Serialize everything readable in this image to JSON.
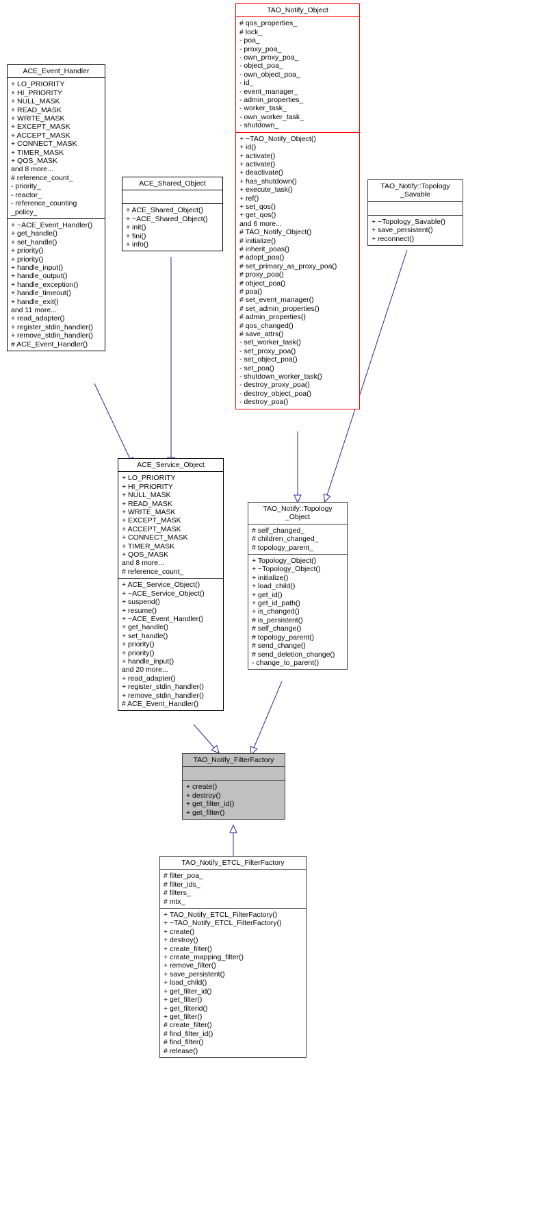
{
  "diagram": {
    "title": "TAO_Notify_FilterFactory inheritance diagram",
    "colors": {
      "highlight_border": "#ff0000",
      "selected_fill": "#c0c0c0",
      "edge": "#25258f",
      "default_border": "#000000"
    }
  },
  "classes": {
    "tao_notify_object": {
      "name": "TAO_Notify_Object",
      "attributes": [
        "# qos_properties_",
        "# lock_",
        "- poa_",
        "- proxy_poa_",
        "- own_proxy_poa_",
        "- object_poa_",
        "- own_object_poa_",
        "- id_",
        "- event_manager_",
        "- admin_properties_",
        "- worker_task_",
        "- own_worker_task_",
        "- shutdown_"
      ],
      "operations": [
        "+ ~TAO_Notify_Object()",
        "+ id()",
        "+ activate()",
        "+ activate()",
        "+ deactivate()",
        "+ has_shutdown()",
        "+ execute_task()",
        "+ ref()",
        "+ set_qos()",
        "+ get_qos()",
        "and 6 more...",
        "# TAO_Notify_Object()",
        "# initialize()",
        "# inherit_poas()",
        "# adopt_poa()",
        "# set_primary_as_proxy_poa()",
        "# proxy_poa()",
        "# object_poa()",
        "# poa()",
        "# set_event_manager()",
        "# set_admin_properties()",
        "# admin_properties()",
        "# qos_changed()",
        "# save_attrs()",
        "- set_worker_task()",
        "- set_proxy_poa()",
        "- set_object_poa()",
        "- set_poa()",
        "- shutdown_worker_task()",
        "- destroy_proxy_poa()",
        "- destroy_object_poa()",
        "- destroy_poa()"
      ]
    },
    "ace_event_handler": {
      "name": "ACE_Event_Handler",
      "attributes": [
        "+ LO_PRIORITY",
        "+ HI_PRIORITY",
        "+ NULL_MASK",
        "+ READ_MASK",
        "+ WRITE_MASK",
        "+ EXCEPT_MASK",
        "+ ACCEPT_MASK",
        "+ CONNECT_MASK",
        "+ TIMER_MASK",
        "+ QOS_MASK",
        "and 8 more...",
        "# reference_count_",
        "- priority_",
        "- reactor_",
        "- reference_counting",
        "_policy_"
      ],
      "operations": [
        "+ ~ACE_Event_Handler()",
        "+ get_handle()",
        "+ set_handle()",
        "+ priority()",
        "+ priority()",
        "+ handle_input()",
        "+ handle_output()",
        "+ handle_exception()",
        "+ handle_timeout()",
        "+ handle_exit()",
        "and 11 more...",
        "+ read_adapter()",
        "+ register_stdin_handler()",
        "+ remove_stdin_handler()",
        "# ACE_Event_Handler()"
      ]
    },
    "ace_shared_object": {
      "name": "ACE_Shared_Object",
      "attributes": [],
      "operations": [
        "+ ACE_Shared_Object()",
        "+ ~ACE_Shared_Object()",
        "+ init()",
        "+ fini()",
        "+ info()"
      ]
    },
    "topology_savable": {
      "name": "TAO_Notify::Topology\n_Savable",
      "attributes": [],
      "operations": [
        "+ ~Topology_Savable()",
        "+ save_persistent()",
        "+ reconnect()"
      ]
    },
    "ace_service_object": {
      "name": "ACE_Service_Object",
      "attributes": [
        "+ LO_PRIORITY",
        "+ HI_PRIORITY",
        "+ NULL_MASK",
        "+ READ_MASK",
        "+ WRITE_MASK",
        "+ EXCEPT_MASK",
        "+ ACCEPT_MASK",
        "+ CONNECT_MASK",
        "+ TIMER_MASK",
        "+ QOS_MASK",
        "and 8 more...",
        "# reference_count_"
      ],
      "operations": [
        "+ ACE_Service_Object()",
        "+ ~ACE_Service_Object()",
        "+ suspend()",
        "+ resume()",
        "+ ~ACE_Event_Handler()",
        "+ get_handle()",
        "+ set_handle()",
        "+ priority()",
        "+ priority()",
        "+ handle_input()",
        "and 20 more...",
        "+ read_adapter()",
        "+ register_stdin_handler()",
        "+ remove_stdin_handler()",
        "# ACE_Event_Handler()"
      ]
    },
    "topology_object": {
      "name": "TAO_Notify::Topology\n_Object",
      "attributes": [
        "# self_changed_",
        "# children_changed_",
        "# topology_parent_"
      ],
      "operations": [
        "+ Topology_Object()",
        "+ ~Topology_Object()",
        "+ initialize()",
        "+ load_child()",
        "+ get_id()",
        "+ get_id_path()",
        "+ is_changed()",
        "# is_persistent()",
        "# self_change()",
        "# topology_parent()",
        "# send_change()",
        "# send_deletion_change()",
        "- change_to_parent()"
      ]
    },
    "filter_factory": {
      "name": "TAO_Notify_FilterFactory",
      "attributes": [],
      "operations": [
        "+ create()",
        "+ destroy()",
        "+ get_filter_id()",
        "+ get_filter()"
      ]
    },
    "etcl_filter_factory": {
      "name": "TAO_Notify_ETCL_FilterFactory",
      "attributes": [
        "# filter_poa_",
        "# filter_ids_",
        "# filters_",
        "# mtx_"
      ],
      "operations": [
        "+ TAO_Notify_ETCL_FilterFactory()",
        "+ ~TAO_Notify_ETCL_FilterFactory()",
        "+ create()",
        "+ destroy()",
        "+ create_filter()",
        "+ create_mapping_filter()",
        "+ remove_filter()",
        "+ save_persistent()",
        "+ load_child()",
        "+ get_filter_id()",
        "+ get_filter()",
        "+ get_filterid()",
        "+ get_filter()",
        "# create_filter()",
        "# find_filter_id()",
        "# find_filter()",
        "# release()"
      ]
    }
  }
}
